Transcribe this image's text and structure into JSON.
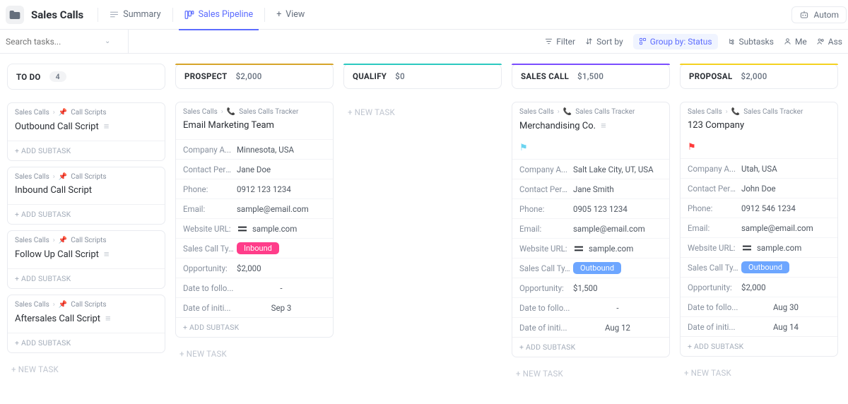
{
  "header": {
    "title": "Sales Calls",
    "tabs": {
      "summary": "Summary",
      "pipeline": "Sales Pipeline",
      "addView": "View"
    },
    "automations": "Autom"
  },
  "toolbar": {
    "search_placeholder": "Search tasks...",
    "filter": "Filter",
    "sort": "Sort by",
    "groupby": "Group by: Status",
    "subtasks": "Subtasks",
    "me": "Me",
    "assignees": "Ass"
  },
  "labels": {
    "add_subtask": "+ ADD SUBTASK",
    "new_task": "+ NEW TASK",
    "company": "Company A...",
    "contact": "Contact Pers...",
    "phone": "Phone:",
    "email": "Email:",
    "website": "Website URL:",
    "calltype": "Sales Call Ty...",
    "opportunity": "Opportunity:",
    "followup": "Date to follo...",
    "initdate": "Date of initi..."
  },
  "crumbs": {
    "root": "Sales Calls",
    "scripts": "Call Scripts",
    "tracker": "Sales Calls Tracker"
  },
  "columns": {
    "todo": {
      "name": "TO DO",
      "count": "4"
    },
    "prospect": {
      "name": "PROSPECT",
      "amount": "$2,000"
    },
    "qualify": {
      "name": "QUALIFY",
      "amount": "$0"
    },
    "salescall": {
      "name": "SALES CALL",
      "amount": "$1,500"
    },
    "proposal": {
      "name": "PROPOSAL",
      "amount": "$2,000"
    }
  },
  "todo_cards": [
    {
      "title": "Outbound Call Script"
    },
    {
      "title": "Inbound Call Script"
    },
    {
      "title": "Follow Up Call Script"
    },
    {
      "title": "Aftersales Call Script"
    }
  ],
  "prospect_card": {
    "title": "Email Marketing Team",
    "company": "Minnesota, USA",
    "contact": "Jane Doe",
    "phone": "0912 123 1234",
    "email": "sample@email.com",
    "website": "sample.com",
    "calltype": "Inbound",
    "opportunity": "$2,000",
    "followup": "-",
    "initdate": "Sep 3"
  },
  "salescall_card": {
    "title": "Merchandising Co.",
    "flag_color": "#6bd4f0",
    "company": "Salt Lake City, UT, USA",
    "contact": "Jane Smith",
    "phone": "0905 123 1234",
    "email": "sample@email.com",
    "website": "sample.com",
    "calltype": "Outbound",
    "opportunity": "$1,500",
    "followup": "-",
    "initdate": "Aug 12"
  },
  "proposal_card": {
    "title": "123 Company",
    "flag_color": "#ff3b3b",
    "company": "Utah, USA",
    "contact": "John Doe",
    "phone": "0912 546 1234",
    "email": "sample@email.com",
    "website": "sample.com",
    "calltype": "Outbound",
    "opportunity": "$2,000",
    "followup": "Aug 30",
    "initdate": "Aug 14"
  }
}
